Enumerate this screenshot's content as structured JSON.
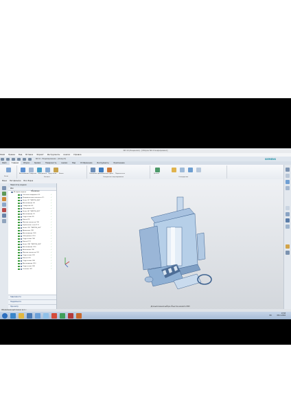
{
  "window": {
    "title": "NX 10 (Лицензия) - [Сборка NX Сгенерировано]"
  },
  "menu": [
    "Файл",
    "Правка",
    "Вид",
    "Вставка",
    "Формат",
    "Инструменты",
    "Анализ",
    "Справка"
  ],
  "quick_access": {
    "crumb": "NX 10 - Моделирование - [draw.prt]",
    "brand": "SIEMENS"
  },
  "ribbon_tabs": [
    "Файл",
    "Главная",
    "Сборки",
    "Кривая",
    "Поверхность",
    "Анализ",
    "Вид",
    "Отображение",
    "Инструменты",
    "Приложение"
  ],
  "ribbon_active_tab": "Главная",
  "ribbon": {
    "groups": [
      {
        "label": "Эскиз"
      },
      {
        "label": "Элемент"
      },
      {
        "label": "Синхронное моделирование"
      },
      {
        "label": "Стандартные"
      }
    ],
    "buttons": [
      {
        "label": "Вытягивание",
        "color": "#5b8fd1"
      },
      {
        "label": "Отверстие",
        "color": "#a2b8d4"
      },
      {
        "label": "Объединить",
        "color": "#4aa0c8"
      },
      {
        "label": "Скругление",
        "color": "#8aaed6"
      },
      {
        "label": "Фаска",
        "color": "#c7a24a"
      },
      {
        "label": "Смещение грани",
        "color": "#6c8db7"
      },
      {
        "label": "Заменить грань",
        "color": "#3e7cc0"
      },
      {
        "label": "Переместить",
        "color": "#d07b3a"
      },
      {
        "label": "Деталь",
        "color": "#4d9a6a"
      }
    ]
  },
  "filter_bar": {
    "menu_label": "Меню",
    "filter": "Нет фильтра",
    "scope": "Вся сборка"
  },
  "navigator": {
    "title": "Навигатор модели",
    "columns": [
      "Имя",
      "Обновлено"
    ],
    "items": [
      "История модели",
      "Система координат (0)",
      "Координатная плоскость (1)",
      "Эскиз (2) \"SKETCH_000\"",
      "Вытягивание (3)",
      "Отверстие (4)",
      "Объединить (5)",
      "Эскиз (6) \"SKETCH_001\"",
      "Вытягивание (7)",
      "Скругление (8)",
      "Фаска (9)",
      "Массив элемента (10)",
      "Зеркальное тело (11)",
      "Эскиз (12) \"SKETCH_002\"",
      "Вращение (13)",
      "Вытягивание (14)",
      "Объединить (15)",
      "Скругление (16)",
      "Фаска (17)",
      "Эскиз (18) \"SKETCH_003\"",
      "Вытягивание (19)",
      "Вычитание (20)",
      "Массив элемента (21)",
      "Скругление (22)",
      "Фаска (23)",
      "Скругление (24)",
      "Вытягивание (25)",
      "Скругление (26)",
      "Сечение (27)"
    ],
    "check_mark": "✓",
    "sections": [
      "Зависимости",
      "Подробности",
      "Просмотр"
    ]
  },
  "viewport_hint": "Для выполнения выбора объектов нажмите ЛКМ",
  "status": "Обновление выполнено за 1 с",
  "tray": {
    "language": "RU",
    "time": "13:58",
    "date": "08.11.2016"
  },
  "colors": {
    "accent": "#1b8ea3",
    "ok": "#2a9a2a",
    "model_fill": "#b6cfe8",
    "model_dark": "#4d6d96"
  }
}
